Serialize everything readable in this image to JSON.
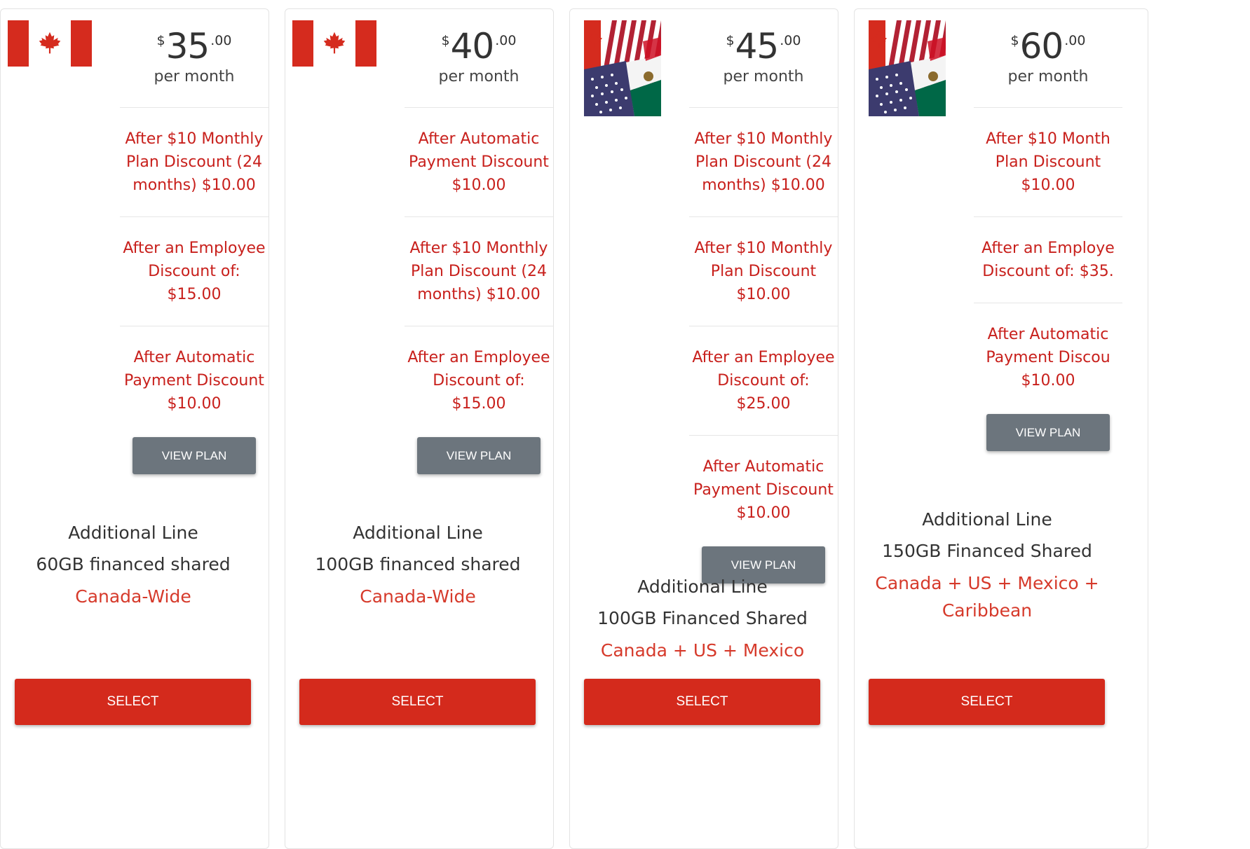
{
  "plans": [
    {
      "flag": "canada-flag-icon",
      "price": {
        "currency": "$",
        "amount": "35",
        "cents": ".00",
        "period": "per month"
      },
      "discounts": [
        "After $10 Monthly\nPlan Discount (24\nmonths) $10.00",
        "After an Employee\nDiscount of: $15.00",
        "After Automatic\nPayment Discount\n$10.00"
      ],
      "view_label": "VIEW PLAN",
      "additional": {
        "title": "Additional Line",
        "data": "60GB financed shared",
        "coverage": "Canada-Wide"
      },
      "select_label": "SELECT"
    },
    {
      "flag": "canada-flag-icon",
      "price": {
        "currency": "$",
        "amount": "40",
        "cents": ".00",
        "period": "per month"
      },
      "discounts": [
        "After Automatic\nPayment Discount\n$10.00",
        "After $10 Monthly\nPlan Discount (24\nmonths) $10.00",
        "After an Employee\nDiscount of: $15.00"
      ],
      "view_label": "VIEW PLAN",
      "additional": {
        "title": "Additional Line",
        "data": "100GB financed shared",
        "coverage": "Canada-Wide"
      },
      "select_label": "SELECT"
    },
    {
      "flag": "canada-us-mexico-flags-icon",
      "price": {
        "currency": "$",
        "amount": "45",
        "cents": ".00",
        "period": "per month"
      },
      "discounts": [
        "After $10 Monthly\nPlan Discount (24\nmonths) $10.00",
        "After $10 Monthly\nPlan Discount\n$10.00",
        "After an Employee\nDiscount of: $25.00",
        "After Automatic\nPayment Discount\n$10.00"
      ],
      "view_label": "VIEW PLAN",
      "additional": {
        "title": "Additional Line",
        "data": "100GB Financed Shared",
        "coverage": "Canada + US + Mexico"
      },
      "select_label": "SELECT"
    },
    {
      "flag": "canada-us-mexico-flags-icon",
      "price": {
        "currency": "$",
        "amount": "60",
        "cents": ".00",
        "period": "per month"
      },
      "discounts": [
        "After $10 Month\nPlan Discount\n$10.00",
        "After an Employe\nDiscount of: $35.",
        "After Automatic\nPayment Discou\n$10.00"
      ],
      "view_label": "VIEW PLAN",
      "additional": {
        "title": "Additional Line",
        "data": "150GB Financed Shared",
        "coverage": "Canada + US + Mexico +\nCaribbean"
      },
      "select_label": "SELECT"
    }
  ]
}
